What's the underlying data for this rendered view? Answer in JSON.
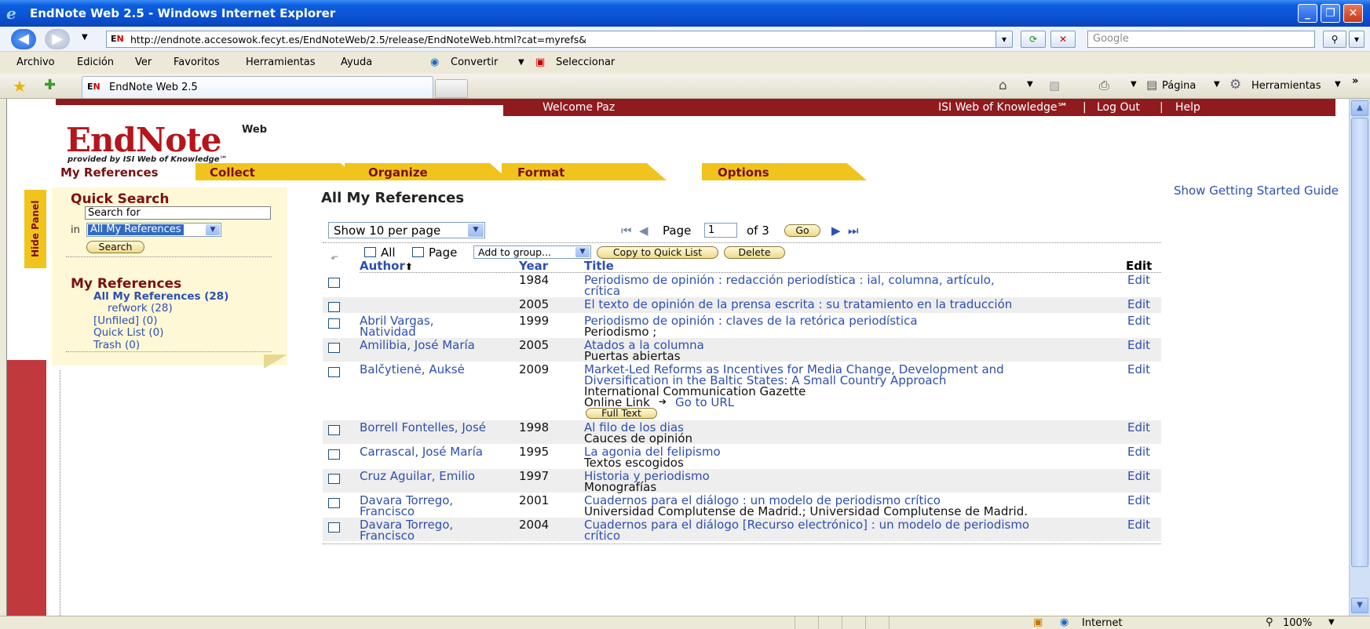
{
  "window": {
    "title": "EndNote Web 2.5 - Windows Internet Explorer",
    "url": "http://endnote.accesowok.fecyt.es/EndNoteWeb/2.5/release/EndNoteWeb.html?cat=myrefs&",
    "search_placeholder": "Google"
  },
  "menu": {
    "items": [
      "Archivo",
      "Edición",
      "Ver",
      "Favoritos",
      "Herramientas",
      "Ayuda"
    ],
    "convertir": "Convertir",
    "seleccionar": "Seleccionar"
  },
  "favbar": {
    "tab_title": "EndNote Web 2.5",
    "pagina": "Página",
    "herramientas": "Herramientas"
  },
  "topnav": {
    "welcome": "Welcome Paz",
    "isi": "ISI Web of Knowledge℠",
    "logout": "Log Out",
    "help": "Help"
  },
  "logo": {
    "name": "EndNote",
    "web": "Web",
    "sub": "provided by ISI Web of Knowledge℠"
  },
  "tabs": [
    "My References",
    "Collect",
    "Organize",
    "Format",
    "Options"
  ],
  "guide_link": "Show Getting Started Guide",
  "quick_search": {
    "hide_panel": "Hide Panel",
    "title": "Quick Search",
    "input_value": "Search for",
    "in_label": "in",
    "scope": "All My References",
    "button": "Search"
  },
  "my_references": {
    "title": "My References",
    "folders": [
      "All My References (28)",
      "refwork (28)",
      "[Unfiled] (0)",
      "Quick List (0)",
      "Trash (0)"
    ]
  },
  "main": {
    "title": "All My References",
    "per_page": "Show 10 per page",
    "page_label": "Page",
    "page_value": "1",
    "of_label": "of 3",
    "go": "Go",
    "all_label": "All",
    "page_cb_label": "Page",
    "add_group": "Add to group...",
    "copy_quick": "Copy to Quick List",
    "delete": "Delete",
    "col_author": "Author",
    "col_year": "Year",
    "col_title": "Title",
    "col_edit": "Edit"
  },
  "references": [
    {
      "author": [
        "",
        ""
      ],
      "year": "1984",
      "title": [
        "Periodismo de opinión : redacción periodística : ial, columna, artículo,",
        "crítica"
      ],
      "source": "",
      "edit": "Edit"
    },
    {
      "author": [
        "",
        ""
      ],
      "year": "2005",
      "title": [
        "El texto de opinión de la prensa escrita : su tratamiento en la traducción",
        ""
      ],
      "source": "",
      "edit": "Edit"
    },
    {
      "author": [
        "Abril Vargas,",
        "Natividad"
      ],
      "year": "1999",
      "title": [
        "Periodismo de opinión : claves de la retórica periodística",
        ""
      ],
      "source": "Periodismo ;",
      "edit": "Edit"
    },
    {
      "author": [
        "Amilibia, José María",
        ""
      ],
      "year": "2005",
      "title": [
        "Atados a la columna",
        ""
      ],
      "source": "Puertas abiertas",
      "edit": "Edit"
    },
    {
      "author": [
        "Balčytienė, Auksė",
        ""
      ],
      "year": "2009",
      "title": [
        "Market-Led Reforms as Incentives for Media Change, Development and",
        "Diversification in the Baltic States: A Small Country Approach"
      ],
      "source": "International Communication Gazette",
      "online_label": "Online Link",
      "online_link": "Go to URL",
      "full_text": "Full Text",
      "edit": "Edit"
    },
    {
      "author": [
        "Borrell Fontelles, José",
        ""
      ],
      "year": "1998",
      "title": [
        "Al filo de los dias",
        ""
      ],
      "source": "Cauces de opinión",
      "edit": "Edit"
    },
    {
      "author": [
        "Carrascal, José María",
        ""
      ],
      "year": "1995",
      "title": [
        "La agonia del felipismo",
        ""
      ],
      "source": "Textos escogidos",
      "edit": "Edit"
    },
    {
      "author": [
        "Cruz Aguilar, Emilio",
        ""
      ],
      "year": "1997",
      "title": [
        "Historia y periodismo",
        ""
      ],
      "source": "Monografías",
      "edit": "Edit"
    },
    {
      "author": [
        "Davara Torrego,",
        "Francisco"
      ],
      "year": "2001",
      "title": [
        "Cuadernos para el diálogo : un modelo de periodismo crítico",
        ""
      ],
      "source": "Universidad Complutense de Madrid.; Universidad Complutense de Madrid.",
      "edit": "Edit"
    },
    {
      "author": [
        "Davara Torrego,",
        "Francisco"
      ],
      "year": "2004",
      "title": [
        "Cuadernos para el diálogo [Recurso electrónico] : un modelo de periodismo",
        "crítico"
      ],
      "source": "",
      "edit": "Edit"
    }
  ],
  "status": {
    "zone": "Internet",
    "zoom": "100%"
  },
  "colors": {
    "brand_red": "#8f1b1f",
    "tab_yellow": "#f1c41d",
    "link_blue": "#2d4fb0"
  }
}
